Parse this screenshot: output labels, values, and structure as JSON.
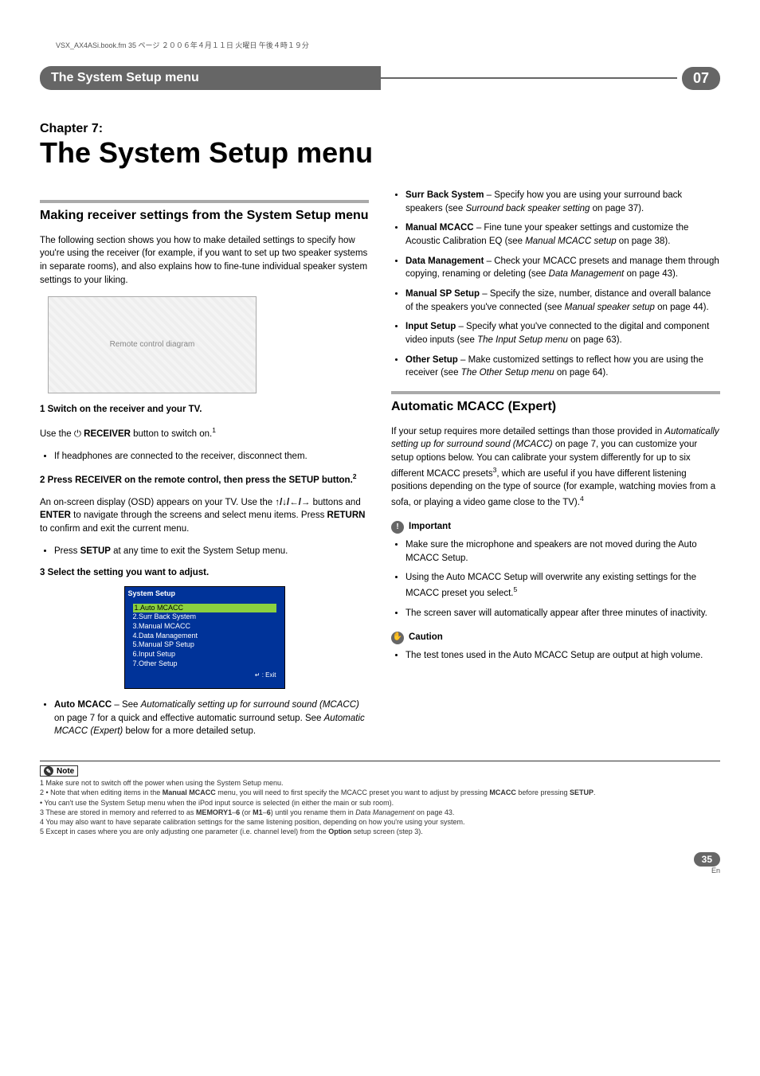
{
  "header_line": "VSX_AX4ASi.book.fm 35 ページ ２００６年４月１１日 火曜日 午後４時１９分",
  "titlebar": {
    "left": "The System Setup menu",
    "right": "07"
  },
  "chapter": {
    "label": "Chapter 7:",
    "title": "The System Setup menu"
  },
  "left": {
    "section_title": "Making receiver settings from the System Setup menu",
    "intro": "The following section shows you how to make detailed settings to specify how you're using the receiver (for example, if you want to set up two speaker systems in separate rooms), and also explains how to fine-tune individual speaker system settings to your liking.",
    "remote_alt": "Remote control diagram",
    "step1": "1   Switch on the receiver and your TV.",
    "step1_line_a": "Use the ",
    "step1_power": "⏻",
    "step1_line_b": " RECEIVER",
    "step1_line_c": " button to switch on.",
    "step1_sup": "1",
    "step1_bullet": "If headphones are connected to the receiver, disconnect them.",
    "step2": "2   Press RECEIVER on the remote control, then press the SETUP button.",
    "step2_sup": "2",
    "step2_p1a": "An on-screen display (OSD) appears on your TV. Use the ",
    "step2_arrows": "↑/↓/←/→",
    "step2_p1b": " buttons and ",
    "step2_enter": "ENTER",
    "step2_p1c": " to navigate through the screens and select menu items. Press ",
    "step2_return": "RETURN",
    "step2_p1d": " to confirm and exit the current menu.",
    "step2_bullet_a": "Press ",
    "step2_bullet_setup": "SETUP",
    "step2_bullet_b": " at any time to exit the System Setup menu.",
    "step3": "3   Select the setting you want to adjust.",
    "osd": {
      "title": "System Setup",
      "item1": "1.Auto MCACC",
      "item2": "2.Surr Back System",
      "item3": "3.Manual MCACC",
      "item4": "4.Data Management",
      "item5": "5.Manual SP Setup",
      "item6": "6.Input Setup",
      "item7": "7.Other Setup",
      "exit": "↵ : Exit"
    },
    "auto_mcacc_a": "Auto MCACC",
    "auto_mcacc_b": " – See ",
    "auto_mcacc_c": "Automatically setting up for surround sound (MCACC)",
    "auto_mcacc_d": " on page 7 for a quick and effective automatic surround setup. See ",
    "auto_mcacc_e": "Automatic MCACC (Expert)",
    "auto_mcacc_f": " below for a more detailed setup."
  },
  "right": {
    "bullets": {
      "surr_a": "Surr Back System",
      "surr_b": " – Specify how you are using your surround back speakers (see ",
      "surr_c": "Surround back speaker setting",
      "surr_d": " on page 37).",
      "man_a": "Manual MCACC",
      "man_b": " – Fine tune your speaker settings and customize the Acoustic Calibration EQ (see ",
      "man_c": "Manual MCACC setup",
      "man_d": " on page 38).",
      "data_a": "Data Management",
      "data_b": " – Check your MCACC presets and manage them through copying, renaming or deleting (see ",
      "data_c": "Data Management",
      "data_d": " on page 43).",
      "msp_a": "Manual SP Setup",
      "msp_b": " – Specify the size, number, distance and overall balance of the speakers you've connected (see ",
      "msp_c": "Manual speaker setup",
      "msp_d": " on page 44).",
      "inp_a": "Input Setup",
      "inp_b": " – Specify what you've connected to the digital and component video inputs (see ",
      "inp_c": "The Input Setup menu",
      "inp_d": " on page 63).",
      "oth_a": "Other Setup",
      "oth_b": " – Make customized settings to reflect how you are using the receiver (see ",
      "oth_c": "The Other Setup menu",
      "oth_d": " on page 64)."
    },
    "section2_title": "Automatic MCACC (Expert)",
    "section2_p_a": "If your setup requires more detailed settings than those provided in ",
    "section2_p_b": "Automatically setting up for surround sound (MCACC)",
    "section2_p_c": " on page 7, you can customize your setup options below. You can calibrate your system differently for up to six different MCACC presets",
    "section2_sup3": "3",
    "section2_p_d": ", which are useful if you have different listening positions depending on the type of source (for example, watching movies from a sofa, or playing a video game close to the TV).",
    "section2_sup4": "4",
    "important_label": "Important",
    "imp_b1": "Make sure the microphone and speakers are not moved during the Auto MCACC Setup.",
    "imp_b2a": "Using the Auto MCACC Setup will overwrite any existing settings for the MCACC preset you select.",
    "imp_b2_sup": "5",
    "imp_b3": "The screen saver will automatically appear after three minutes of inactivity.",
    "caution_label": "Caution",
    "caution_b1": "The test tones used in the Auto MCACC Setup are output at high volume."
  },
  "notes": {
    "label": "Note",
    "n1": "1 Make sure not to switch off the power when using the System Setup menu.",
    "n2a": "2 • Note that when editing items in the ",
    "n2b": "Manual MCACC",
    "n2c": " menu, you will need to first specify the MCACC preset you want to adjust by pressing ",
    "n2d": "MCACC",
    "n2e": " before pressing ",
    "n2f": "SETUP",
    "n2g": ".",
    "n2_2": "   • You can't use the System Setup menu when the iPod input source is selected (in either the main or sub room).",
    "n3a": "3 These are stored in memory and referred to as ",
    "n3b": "MEMORY1",
    "n3c": "–",
    "n3d": "6",
    "n3e": " (or ",
    "n3f": "M1",
    "n3g": "–",
    "n3h": "6",
    "n3i": ") until you rename them in ",
    "n3j": "Data Management",
    "n3k": " on page 43.",
    "n4": "4 You may also want to have separate calibration settings for the same listening position, depending on how you're using your system.",
    "n5a": "5 Except in cases where you are only adjusting one parameter (i.e. channel level) from the ",
    "n5b": "Option",
    "n5c": " setup screen (step 3)."
  },
  "page_number": "35",
  "page_lang": "En"
}
